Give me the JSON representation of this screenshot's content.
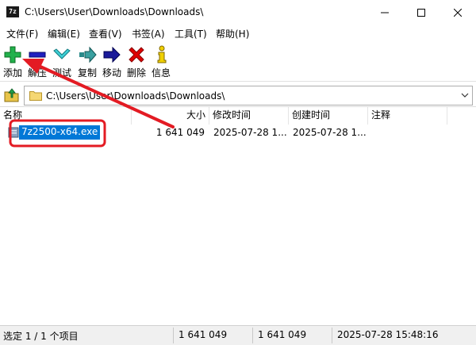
{
  "window": {
    "title": "C:\\Users\\User\\Downloads\\Downloads\\",
    "app_icon_text": "7z"
  },
  "menu": [
    "文件(F)",
    "编辑(E)",
    "查看(V)",
    "书签(A)",
    "工具(T)",
    "帮助(H)"
  ],
  "toolbar": {
    "add": "添加",
    "extract": "解压",
    "test": "测试",
    "copy": "复制",
    "move": "移动",
    "delete": "删除",
    "info": "信息"
  },
  "address": {
    "path": "C:\\Users\\User\\Downloads\\Downloads\\"
  },
  "columns": {
    "name": "名称",
    "size": "大小",
    "modified": "修改时间",
    "created": "创建时间",
    "comment": "注释"
  },
  "files": [
    {
      "name": "7z2500-x64.exe",
      "size": "1 641 049",
      "modified": "2025-07-28 1...",
      "created": "2025-07-28 1...",
      "comment": ""
    }
  ],
  "status": {
    "selection": "选定 1 / 1 个项目",
    "size": "1 641 049",
    "packed": "1 641 049",
    "datetime": "2025-07-28 15:48:16"
  },
  "colors": {
    "selection": "#0078d7",
    "annotation": "#e31b23",
    "add_icon": "#22b14c",
    "extract_icon": "#1f1fbf"
  }
}
